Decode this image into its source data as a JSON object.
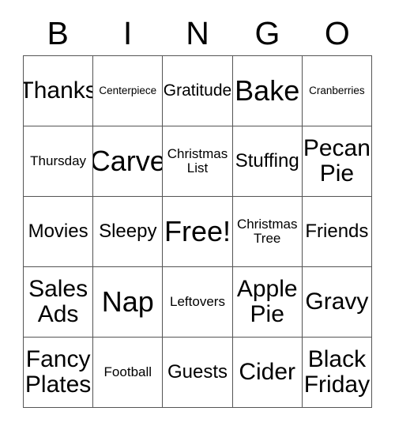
{
  "card": {
    "title": "BINGO",
    "header_letters": [
      "B",
      "I",
      "N",
      "G",
      "O"
    ],
    "colors": {
      "background": "#ffffff",
      "text": "#000000",
      "grid_line": "#555555"
    },
    "grid_size": "5x5",
    "free_space_label": "Free!",
    "free_space_position": "row3-col3",
    "rows": [
      [
        {
          "label": "Thanks",
          "size": "lg"
        },
        {
          "label": "Centerpiece",
          "size": "xxs"
        },
        {
          "label": "Gratitude",
          "size": "sm"
        },
        {
          "label": "Bake",
          "size": "xl"
        },
        {
          "label": "Cranberries",
          "size": "xxs"
        }
      ],
      [
        {
          "label": "Thursday",
          "size": "xs"
        },
        {
          "label": "Carve",
          "size": "xl"
        },
        {
          "label": "Christmas\nList",
          "size": "xs"
        },
        {
          "label": "Stuffing",
          "size": "md"
        },
        {
          "label": "Pecan\nPie",
          "size": "lg"
        }
      ],
      [
        {
          "label": "Movies",
          "size": "md"
        },
        {
          "label": "Sleepy",
          "size": "md"
        },
        {
          "label": "Free!",
          "size": "xl"
        },
        {
          "label": "Christmas\nTree",
          "size": "xs"
        },
        {
          "label": "Friends",
          "size": "md"
        }
      ],
      [
        {
          "label": "Sales\nAds",
          "size": "lg"
        },
        {
          "label": "Nap",
          "size": "xl"
        },
        {
          "label": "Leftovers",
          "size": "xs"
        },
        {
          "label": "Apple\nPie",
          "size": "lg"
        },
        {
          "label": "Gravy",
          "size": "lg"
        }
      ],
      [
        {
          "label": "Fancy\nPlates",
          "size": "lg"
        },
        {
          "label": "Football",
          "size": "xs"
        },
        {
          "label": "Guests",
          "size": "md"
        },
        {
          "label": "Cider",
          "size": "lg"
        },
        {
          "label": "Black\nFriday",
          "size": "lg"
        }
      ]
    ]
  }
}
